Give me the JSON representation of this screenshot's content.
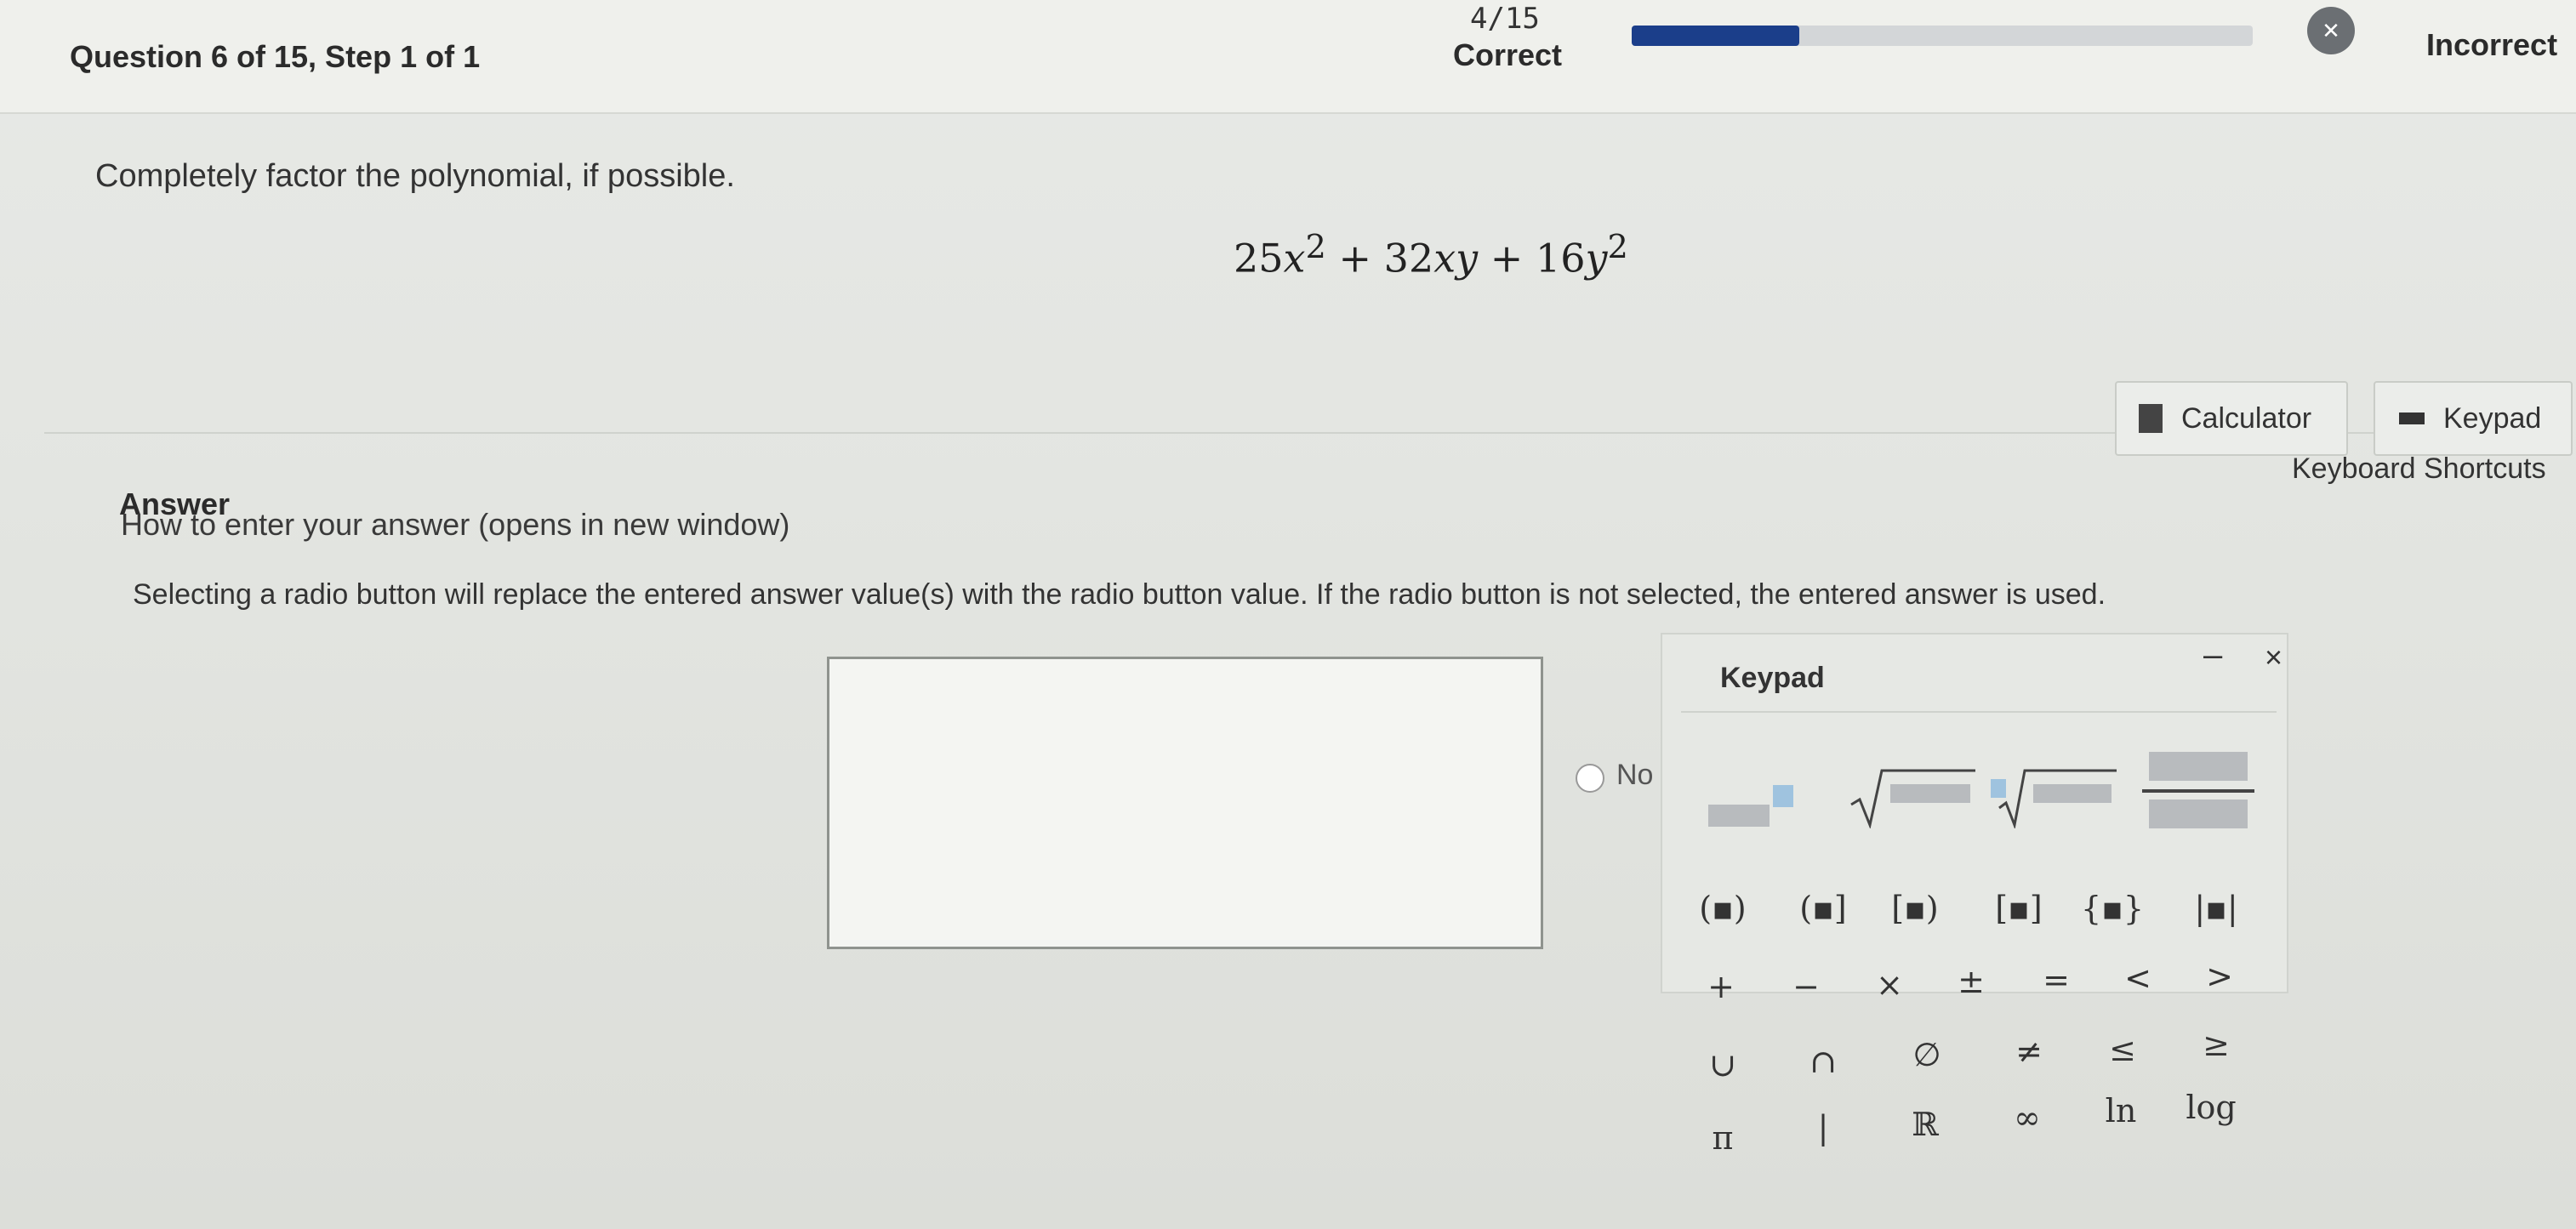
{
  "header": {
    "question_title": "Question 6 of 15,  Step 1 of 1",
    "score": "4/15",
    "correct_label": "Correct",
    "progress": 0.27,
    "incorrect_label": "Incorrect",
    "incorrect_icon": "x-circle-icon"
  },
  "question": {
    "instruction": "Completely factor the polynomial, if possible.",
    "polynomial": {
      "t1": "25",
      "v1": "x",
      "e1": "2",
      "t2": " + 32",
      "v2": "xy",
      "t3": " + 16",
      "v3": "y",
      "e3": "2"
    }
  },
  "tools": {
    "calculator_label": "Calculator",
    "keypad_label": "Keypad",
    "keyboard_shortcuts": "Keyboard Shortcuts"
  },
  "answer": {
    "heading": "Answer",
    "how_to_link": "How to enter your answer (opens in new window)",
    "radio_note": "Selecting a radio button will replace the entered answer value(s) with the radio button value. If the radio button is not selected, the entered answer is used.",
    "radio_no_label": "No"
  },
  "keypad": {
    "title": "Keypad",
    "minimize": "–",
    "close": "×",
    "row2": [
      "(▪)",
      "(▪]",
      "[▪)",
      "[▪]",
      "{▪}",
      "|▪|"
    ],
    "row3": [
      "+",
      "−",
      "×",
      "±",
      "=",
      "<",
      ">"
    ],
    "row4": [
      "∪",
      "∩",
      "∅",
      "≠",
      "≤",
      "≥"
    ],
    "row5": [
      "π",
      "|",
      "ℝ",
      "∞",
      "ln",
      "log"
    ]
  }
}
